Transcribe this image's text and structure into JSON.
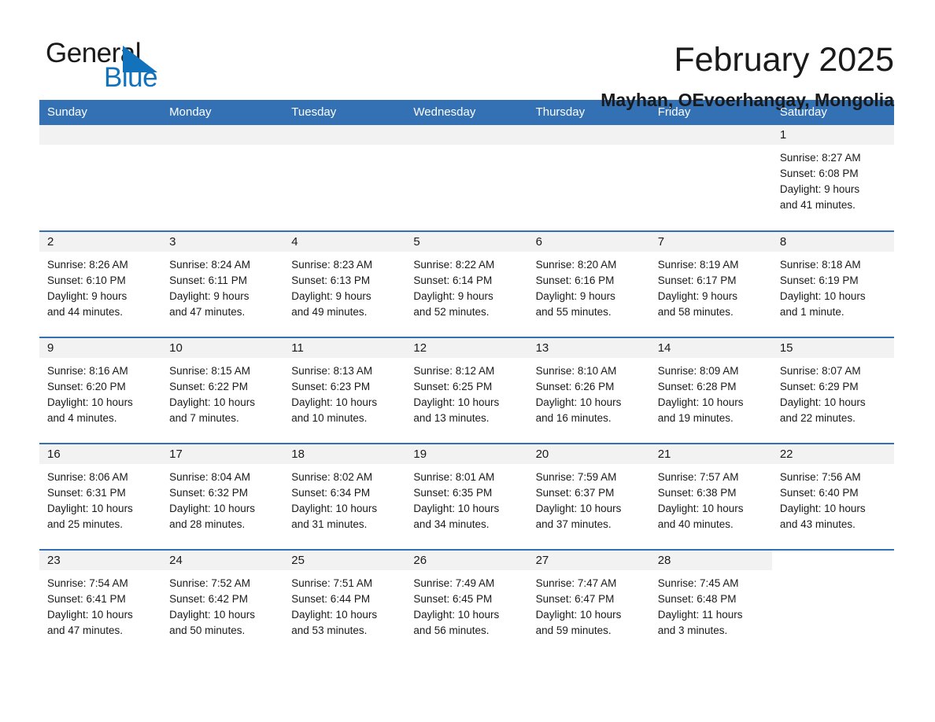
{
  "logo": {
    "word1": "General",
    "word2": "Blue",
    "triangle_color": "#1272bb",
    "word1_color": "#1a1a1a",
    "word2_color": "#1272bb"
  },
  "header": {
    "title": "February 2025",
    "subtitle": "Mayhan, OEvoerhangay, Mongolia"
  },
  "theme": {
    "header_bg": "#3371b4",
    "daynum_bg": "#f2f2f2",
    "row_rule": "#3371b4",
    "text": "#1a1a1a"
  },
  "calendar": {
    "weekday_headers": [
      "Sunday",
      "Monday",
      "Tuesday",
      "Wednesday",
      "Thursday",
      "Friday",
      "Saturday"
    ],
    "labels": {
      "sunrise": "Sunrise:",
      "sunset": "Sunset:",
      "daylight": "Daylight:"
    },
    "weeks": [
      [
        {
          "day": "",
          "lines": []
        },
        {
          "day": "",
          "lines": []
        },
        {
          "day": "",
          "lines": []
        },
        {
          "day": "",
          "lines": []
        },
        {
          "day": "",
          "lines": []
        },
        {
          "day": "",
          "lines": []
        },
        {
          "day": "1",
          "lines": [
            "Sunrise: 8:27 AM",
            "Sunset: 6:08 PM",
            "Daylight: 9 hours",
            "and 41 minutes."
          ]
        }
      ],
      [
        {
          "day": "2",
          "lines": [
            "Sunrise: 8:26 AM",
            "Sunset: 6:10 PM",
            "Daylight: 9 hours",
            "and 44 minutes."
          ]
        },
        {
          "day": "3",
          "lines": [
            "Sunrise: 8:24 AM",
            "Sunset: 6:11 PM",
            "Daylight: 9 hours",
            "and 47 minutes."
          ]
        },
        {
          "day": "4",
          "lines": [
            "Sunrise: 8:23 AM",
            "Sunset: 6:13 PM",
            "Daylight: 9 hours",
            "and 49 minutes."
          ]
        },
        {
          "day": "5",
          "lines": [
            "Sunrise: 8:22 AM",
            "Sunset: 6:14 PM",
            "Daylight: 9 hours",
            "and 52 minutes."
          ]
        },
        {
          "day": "6",
          "lines": [
            "Sunrise: 8:20 AM",
            "Sunset: 6:16 PM",
            "Daylight: 9 hours",
            "and 55 minutes."
          ]
        },
        {
          "day": "7",
          "lines": [
            "Sunrise: 8:19 AM",
            "Sunset: 6:17 PM",
            "Daylight: 9 hours",
            "and 58 minutes."
          ]
        },
        {
          "day": "8",
          "lines": [
            "Sunrise: 8:18 AM",
            "Sunset: 6:19 PM",
            "Daylight: 10 hours",
            "and 1 minute."
          ]
        }
      ],
      [
        {
          "day": "9",
          "lines": [
            "Sunrise: 8:16 AM",
            "Sunset: 6:20 PM",
            "Daylight: 10 hours",
            "and 4 minutes."
          ]
        },
        {
          "day": "10",
          "lines": [
            "Sunrise: 8:15 AM",
            "Sunset: 6:22 PM",
            "Daylight: 10 hours",
            "and 7 minutes."
          ]
        },
        {
          "day": "11",
          "lines": [
            "Sunrise: 8:13 AM",
            "Sunset: 6:23 PM",
            "Daylight: 10 hours",
            "and 10 minutes."
          ]
        },
        {
          "day": "12",
          "lines": [
            "Sunrise: 8:12 AM",
            "Sunset: 6:25 PM",
            "Daylight: 10 hours",
            "and 13 minutes."
          ]
        },
        {
          "day": "13",
          "lines": [
            "Sunrise: 8:10 AM",
            "Sunset: 6:26 PM",
            "Daylight: 10 hours",
            "and 16 minutes."
          ]
        },
        {
          "day": "14",
          "lines": [
            "Sunrise: 8:09 AM",
            "Sunset: 6:28 PM",
            "Daylight: 10 hours",
            "and 19 minutes."
          ]
        },
        {
          "day": "15",
          "lines": [
            "Sunrise: 8:07 AM",
            "Sunset: 6:29 PM",
            "Daylight: 10 hours",
            "and 22 minutes."
          ]
        }
      ],
      [
        {
          "day": "16",
          "lines": [
            "Sunrise: 8:06 AM",
            "Sunset: 6:31 PM",
            "Daylight: 10 hours",
            "and 25 minutes."
          ]
        },
        {
          "day": "17",
          "lines": [
            "Sunrise: 8:04 AM",
            "Sunset: 6:32 PM",
            "Daylight: 10 hours",
            "and 28 minutes."
          ]
        },
        {
          "day": "18",
          "lines": [
            "Sunrise: 8:02 AM",
            "Sunset: 6:34 PM",
            "Daylight: 10 hours",
            "and 31 minutes."
          ]
        },
        {
          "day": "19",
          "lines": [
            "Sunrise: 8:01 AM",
            "Sunset: 6:35 PM",
            "Daylight: 10 hours",
            "and 34 minutes."
          ]
        },
        {
          "day": "20",
          "lines": [
            "Sunrise: 7:59 AM",
            "Sunset: 6:37 PM",
            "Daylight: 10 hours",
            "and 37 minutes."
          ]
        },
        {
          "day": "21",
          "lines": [
            "Sunrise: 7:57 AM",
            "Sunset: 6:38 PM",
            "Daylight: 10 hours",
            "and 40 minutes."
          ]
        },
        {
          "day": "22",
          "lines": [
            "Sunrise: 7:56 AM",
            "Sunset: 6:40 PM",
            "Daylight: 10 hours",
            "and 43 minutes."
          ]
        }
      ],
      [
        {
          "day": "23",
          "lines": [
            "Sunrise: 7:54 AM",
            "Sunset: 6:41 PM",
            "Daylight: 10 hours",
            "and 47 minutes."
          ]
        },
        {
          "day": "24",
          "lines": [
            "Sunrise: 7:52 AM",
            "Sunset: 6:42 PM",
            "Daylight: 10 hours",
            "and 50 minutes."
          ]
        },
        {
          "day": "25",
          "lines": [
            "Sunrise: 7:51 AM",
            "Sunset: 6:44 PM",
            "Daylight: 10 hours",
            "and 53 minutes."
          ]
        },
        {
          "day": "26",
          "lines": [
            "Sunrise: 7:49 AM",
            "Sunset: 6:45 PM",
            "Daylight: 10 hours",
            "and 56 minutes."
          ]
        },
        {
          "day": "27",
          "lines": [
            "Sunrise: 7:47 AM",
            "Sunset: 6:47 PM",
            "Daylight: 10 hours",
            "and 59 minutes."
          ]
        },
        {
          "day": "28",
          "lines": [
            "Sunrise: 7:45 AM",
            "Sunset: 6:48 PM",
            "Daylight: 11 hours",
            "and 3 minutes."
          ]
        },
        {
          "day": "",
          "lines": []
        }
      ]
    ]
  }
}
